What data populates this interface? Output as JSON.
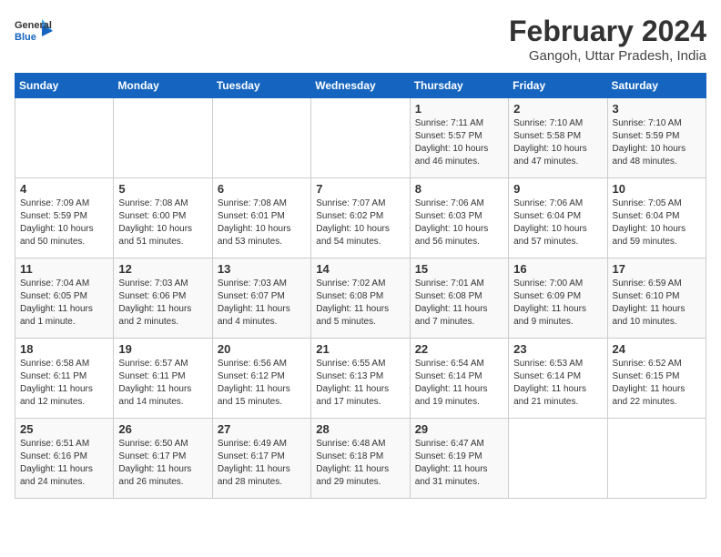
{
  "header": {
    "logo_general": "General",
    "logo_blue": "Blue",
    "month_year": "February 2024",
    "location": "Gangoh, Uttar Pradesh, India"
  },
  "weekdays": [
    "Sunday",
    "Monday",
    "Tuesday",
    "Wednesday",
    "Thursday",
    "Friday",
    "Saturday"
  ],
  "weeks": [
    [
      {
        "day": "",
        "info": ""
      },
      {
        "day": "",
        "info": ""
      },
      {
        "day": "",
        "info": ""
      },
      {
        "day": "",
        "info": ""
      },
      {
        "day": "1",
        "info": "Sunrise: 7:11 AM\nSunset: 5:57 PM\nDaylight: 10 hours\nand 46 minutes."
      },
      {
        "day": "2",
        "info": "Sunrise: 7:10 AM\nSunset: 5:58 PM\nDaylight: 10 hours\nand 47 minutes."
      },
      {
        "day": "3",
        "info": "Sunrise: 7:10 AM\nSunset: 5:59 PM\nDaylight: 10 hours\nand 48 minutes."
      }
    ],
    [
      {
        "day": "4",
        "info": "Sunrise: 7:09 AM\nSunset: 5:59 PM\nDaylight: 10 hours\nand 50 minutes."
      },
      {
        "day": "5",
        "info": "Sunrise: 7:08 AM\nSunset: 6:00 PM\nDaylight: 10 hours\nand 51 minutes."
      },
      {
        "day": "6",
        "info": "Sunrise: 7:08 AM\nSunset: 6:01 PM\nDaylight: 10 hours\nand 53 minutes."
      },
      {
        "day": "7",
        "info": "Sunrise: 7:07 AM\nSunset: 6:02 PM\nDaylight: 10 hours\nand 54 minutes."
      },
      {
        "day": "8",
        "info": "Sunrise: 7:06 AM\nSunset: 6:03 PM\nDaylight: 10 hours\nand 56 minutes."
      },
      {
        "day": "9",
        "info": "Sunrise: 7:06 AM\nSunset: 6:04 PM\nDaylight: 10 hours\nand 57 minutes."
      },
      {
        "day": "10",
        "info": "Sunrise: 7:05 AM\nSunset: 6:04 PM\nDaylight: 10 hours\nand 59 minutes."
      }
    ],
    [
      {
        "day": "11",
        "info": "Sunrise: 7:04 AM\nSunset: 6:05 PM\nDaylight: 11 hours\nand 1 minute."
      },
      {
        "day": "12",
        "info": "Sunrise: 7:03 AM\nSunset: 6:06 PM\nDaylight: 11 hours\nand 2 minutes."
      },
      {
        "day": "13",
        "info": "Sunrise: 7:03 AM\nSunset: 6:07 PM\nDaylight: 11 hours\nand 4 minutes."
      },
      {
        "day": "14",
        "info": "Sunrise: 7:02 AM\nSunset: 6:08 PM\nDaylight: 11 hours\nand 5 minutes."
      },
      {
        "day": "15",
        "info": "Sunrise: 7:01 AM\nSunset: 6:08 PM\nDaylight: 11 hours\nand 7 minutes."
      },
      {
        "day": "16",
        "info": "Sunrise: 7:00 AM\nSunset: 6:09 PM\nDaylight: 11 hours\nand 9 minutes."
      },
      {
        "day": "17",
        "info": "Sunrise: 6:59 AM\nSunset: 6:10 PM\nDaylight: 11 hours\nand 10 minutes."
      }
    ],
    [
      {
        "day": "18",
        "info": "Sunrise: 6:58 AM\nSunset: 6:11 PM\nDaylight: 11 hours\nand 12 minutes."
      },
      {
        "day": "19",
        "info": "Sunrise: 6:57 AM\nSunset: 6:11 PM\nDaylight: 11 hours\nand 14 minutes."
      },
      {
        "day": "20",
        "info": "Sunrise: 6:56 AM\nSunset: 6:12 PM\nDaylight: 11 hours\nand 15 minutes."
      },
      {
        "day": "21",
        "info": "Sunrise: 6:55 AM\nSunset: 6:13 PM\nDaylight: 11 hours\nand 17 minutes."
      },
      {
        "day": "22",
        "info": "Sunrise: 6:54 AM\nSunset: 6:14 PM\nDaylight: 11 hours\nand 19 minutes."
      },
      {
        "day": "23",
        "info": "Sunrise: 6:53 AM\nSunset: 6:14 PM\nDaylight: 11 hours\nand 21 minutes."
      },
      {
        "day": "24",
        "info": "Sunrise: 6:52 AM\nSunset: 6:15 PM\nDaylight: 11 hours\nand 22 minutes."
      }
    ],
    [
      {
        "day": "25",
        "info": "Sunrise: 6:51 AM\nSunset: 6:16 PM\nDaylight: 11 hours\nand 24 minutes."
      },
      {
        "day": "26",
        "info": "Sunrise: 6:50 AM\nSunset: 6:17 PM\nDaylight: 11 hours\nand 26 minutes."
      },
      {
        "day": "27",
        "info": "Sunrise: 6:49 AM\nSunset: 6:17 PM\nDaylight: 11 hours\nand 28 minutes."
      },
      {
        "day": "28",
        "info": "Sunrise: 6:48 AM\nSunset: 6:18 PM\nDaylight: 11 hours\nand 29 minutes."
      },
      {
        "day": "29",
        "info": "Sunrise: 6:47 AM\nSunset: 6:19 PM\nDaylight: 11 hours\nand 31 minutes."
      },
      {
        "day": "",
        "info": ""
      },
      {
        "day": "",
        "info": ""
      }
    ]
  ]
}
